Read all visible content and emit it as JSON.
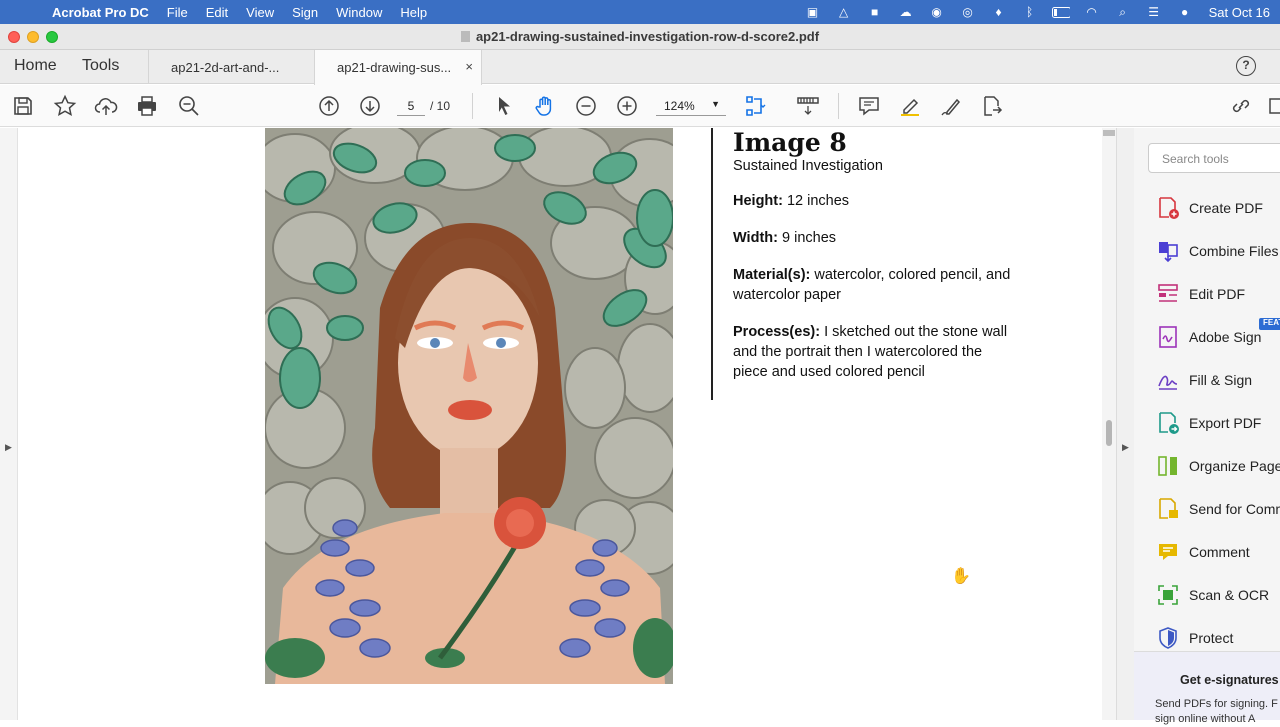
{
  "menubar": {
    "app_name": "Acrobat Pro DC",
    "items": [
      "File",
      "Edit",
      "View",
      "Sign",
      "Window",
      "Help"
    ],
    "clock": "Sat Oct 16"
  },
  "window": {
    "title": "ap21-drawing-sustained-investigation-row-d-score2.pdf"
  },
  "tabs": {
    "home": "Home",
    "tools": "Tools",
    "doc_tabs": [
      "ap21-2d-art-and-...",
      "ap21-drawing-sus..."
    ],
    "close_glyph": "×",
    "help_glyph": "?"
  },
  "toolbar": {
    "current_page": "5",
    "page_of": "/  10",
    "zoom": "124%"
  },
  "document": {
    "image_title": "Image 8",
    "subtitle": "Sustained Investigation",
    "fields": [
      {
        "label": "Height:",
        "value": "12 inches"
      },
      {
        "label": "Width:",
        "value": "9 inches"
      },
      {
        "label": "Material(s):",
        "value": "watercolor, colored pencil, and watercolor paper"
      },
      {
        "label": "Process(es):",
        "value": "I sketched out the stone wall and the portrait then I watercolored the piece and used colored pencil"
      }
    ]
  },
  "tools_panel": {
    "search_placeholder": "Search tools",
    "items": [
      {
        "label": "Create PDF",
        "color": "#d7373f"
      },
      {
        "label": "Combine Files",
        "color": "#4b3fd4"
      },
      {
        "label": "Edit PDF",
        "color": "#c2317a"
      },
      {
        "label": "Adobe Sign",
        "color": "#9d33b9"
      },
      {
        "label": "Fill & Sign",
        "color": "#6c3fc4"
      },
      {
        "label": "Export PDF",
        "color": "#1e9a8a"
      },
      {
        "label": "Organize Pages",
        "color": "#74b52e"
      },
      {
        "label": "Send for Comments",
        "color": "#e6b800"
      },
      {
        "label": "Comment",
        "color": "#e6b800"
      },
      {
        "label": "Scan & OCR",
        "color": "#3aa33a"
      },
      {
        "label": "Protect",
        "color": "#3d59c4"
      }
    ],
    "new_badge": "FEATURED",
    "promo_title": "Get e-signatures",
    "promo_text": [
      "Send PDFs for signing. F",
      "sign online without A"
    ]
  }
}
